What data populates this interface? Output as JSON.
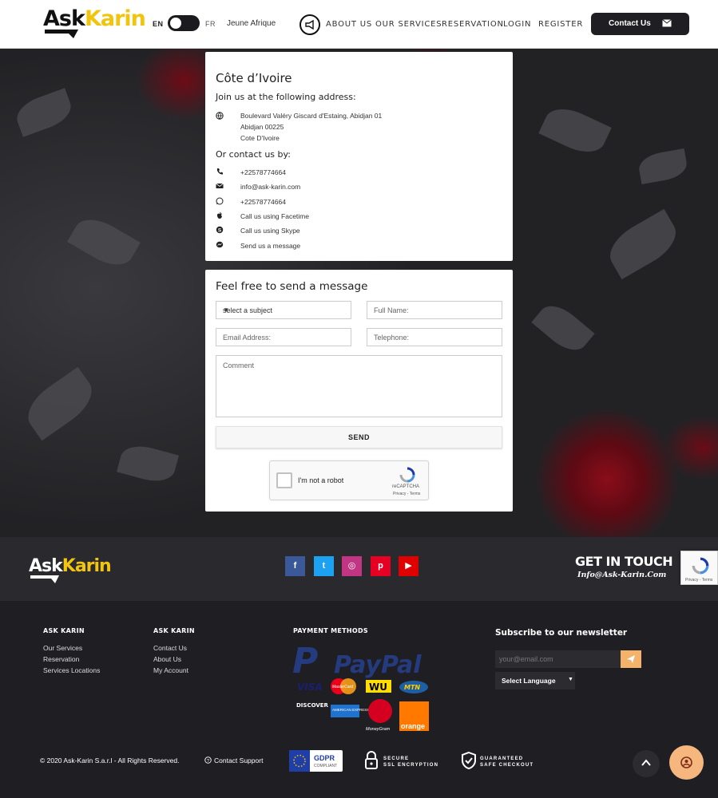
{
  "header": {
    "logo_ask": "Ask",
    "logo_karin": "Karin",
    "lang_en": "EN",
    "lang_fr": "FR",
    "partner_link": "Jeune Afrique",
    "nav": [
      "ABOUT US",
      "OUR SERVICES",
      "RESERVATION",
      "LOGIN",
      "REGISTER"
    ],
    "contact_button": "Contact Us"
  },
  "address_card": {
    "title": "Côte d’Ivoire",
    "join_label": "Join us at the following address:",
    "address_lines": [
      "Boulevard Valéry Giscard d'Estaing, Abidjan 01",
      "Abidjan 00225",
      "Cote D'Ivoire"
    ],
    "contact_label": "Or contact us by:",
    "contacts": [
      {
        "icon": "phone-icon",
        "text": "+22578774664"
      },
      {
        "icon": "envelope-icon",
        "text": "info@ask-karin.com"
      },
      {
        "icon": "whatsapp-icon",
        "text": "+22578774664"
      },
      {
        "icon": "apple-icon",
        "text": "Call us using Facetime"
      },
      {
        "icon": "skype-icon",
        "text": "Call us using Skype"
      },
      {
        "icon": "messenger-icon",
        "text": "Send us a message"
      }
    ]
  },
  "message_form": {
    "title": "Feel free to send a message",
    "subject_selected": "select a subject",
    "full_name_placeholder": "Full Name:",
    "email_placeholder": "Email Address:",
    "telephone_placeholder": "Telephone:",
    "comment_placeholder": "Comment",
    "send_label": "SEND",
    "recaptcha_label": "I'm not a robot",
    "recaptcha_brand": "reCAPTCHA",
    "recaptcha_terms": "Privacy - Terms"
  },
  "band": {
    "logo_ask": "Ask",
    "logo_karin": "Karin",
    "social": [
      {
        "icon": "facebook-icon",
        "glyph": "f",
        "color": "#3b5998"
      },
      {
        "icon": "twitter-icon",
        "glyph": "t",
        "color": "#1da1f2"
      },
      {
        "icon": "instagram-icon",
        "glyph": "◎",
        "color": "#c13584"
      },
      {
        "icon": "pinterest-icon",
        "glyph": "p",
        "color": "#e60023"
      },
      {
        "icon": "youtube-icon",
        "glyph": "▶",
        "color": "#e00000"
      }
    ],
    "get_in_touch": "GET IN TOUCH",
    "email": "Info@Ask-Karin.Com",
    "recaptcha_terms": "Privacy - Terms"
  },
  "footer": {
    "col1_title": "ASK KARIN",
    "col1_links": [
      "Our Services",
      "Reservation",
      "Services Locations"
    ],
    "col2_title": "ASK KARIN",
    "col2_links": [
      "Contact Us",
      "About Us",
      "My Account"
    ],
    "payment_title": "PAYMENT METHODS",
    "payment_logos": [
      "PayPal",
      "VISA",
      "MasterCard",
      "WU",
      "MTN",
      "DISCOVER",
      "AMERICAN EXPRESS",
      "MoneyGram",
      "orange"
    ],
    "newsletter_title": "Subscribe to our newsletter",
    "newsletter_placeholder": "your@email.com",
    "language_select": "Select Language",
    "copyright": "© 2020 Ask-Karin S.a.r.l - All Rights Reserved.",
    "support": "Contact Support",
    "gdpr_title": "GDPR",
    "gdpr_sub": "COMPLIANT",
    "ssl_line1": "SECURE",
    "ssl_line2": "SSL ENCRYPTION",
    "checkout_line1": "GUARANTEED",
    "checkout_line2": "SAFE CHECKOUT"
  },
  "colors": {
    "accent": "#f1c40f",
    "dark": "#1f1e22",
    "newsletter_button": "#f5b26b"
  }
}
